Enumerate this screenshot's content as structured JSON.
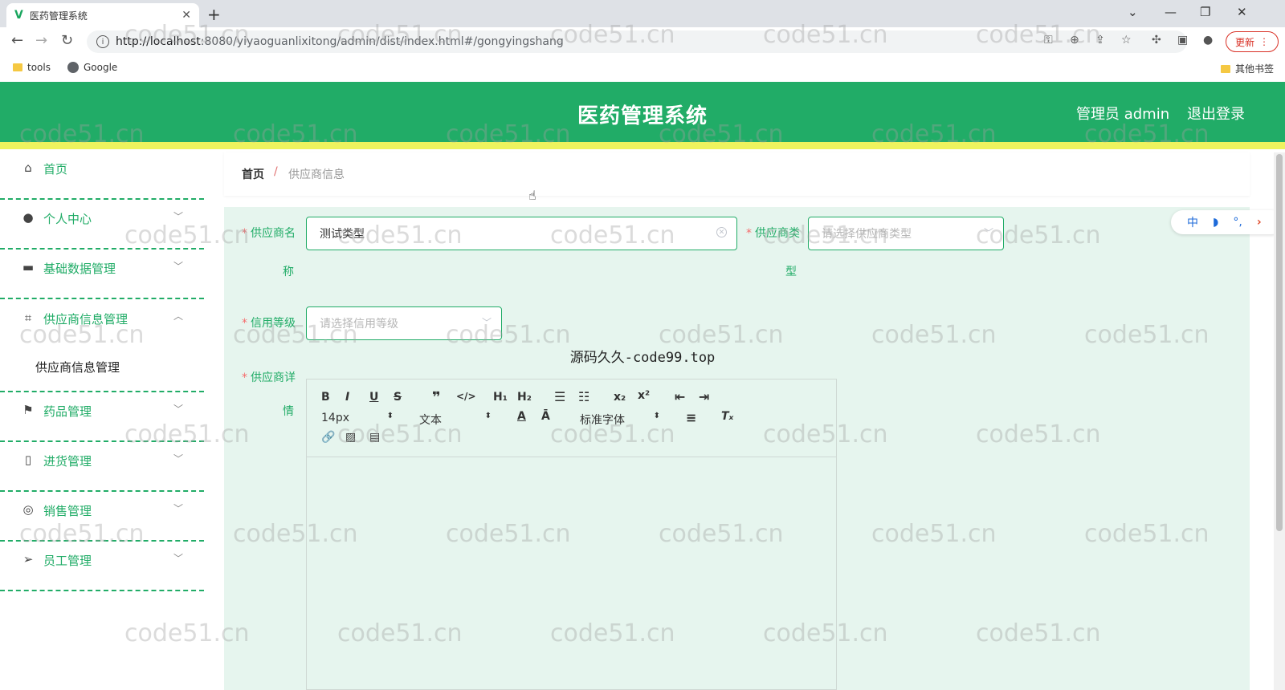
{
  "browser": {
    "tab_title": "医药管理系统",
    "tab_favicon": "V",
    "new_tab": "+",
    "url_host": "http://localhost",
    "url_rest": ":8080/yiyaoguanlixitong/admin/dist/index.html#/gongyingshang",
    "update_label": "更新",
    "bookmarks": [
      "tools",
      "Google"
    ],
    "other_bookmarks": "其他书签"
  },
  "header": {
    "title": "医药管理系统",
    "user": "管理员 admin",
    "logout": "退出登录",
    "accent": "#21ac67",
    "stripe": "#eef35e"
  },
  "sidebar": {
    "items": [
      {
        "label": "首页",
        "icon": "home-icon"
      },
      {
        "label": "个人中心",
        "icon": "user-icon"
      },
      {
        "label": "基础数据管理",
        "icon": "monitor-icon"
      },
      {
        "label": "供应商信息管理",
        "icon": "crop-icon"
      },
      {
        "label": "药品管理",
        "icon": "flag-icon"
      },
      {
        "label": "进货管理",
        "icon": "bottle-icon"
      },
      {
        "label": "销售管理",
        "icon": "target-icon"
      },
      {
        "label": "员工管理",
        "icon": "send-icon"
      }
    ],
    "submenu": "供应商信息管理"
  },
  "breadcrumb": {
    "home": "首页",
    "sep": "/",
    "current": "供应商信息"
  },
  "form": {
    "name_label_1": "供应商名",
    "name_label_2": "称",
    "name_value": "测试类型",
    "type_label_1": "供应商类",
    "type_label_2": "型",
    "type_placeholder": "请选择供应商类型",
    "credit_label": "信用等级",
    "credit_placeholder": "请选择信用等级",
    "detail_label_1": "供应商详",
    "detail_label_2": "情",
    "required_mark": "*"
  },
  "editor": {
    "font_size": "14px",
    "paragraph": "文本",
    "font_family": "标准字体"
  },
  "watermark_text": "源码久久-code99.top",
  "bg_watermark": "code51.cn",
  "float_toolbar": [
    "中",
    "◗",
    "°,",
    "›"
  ]
}
